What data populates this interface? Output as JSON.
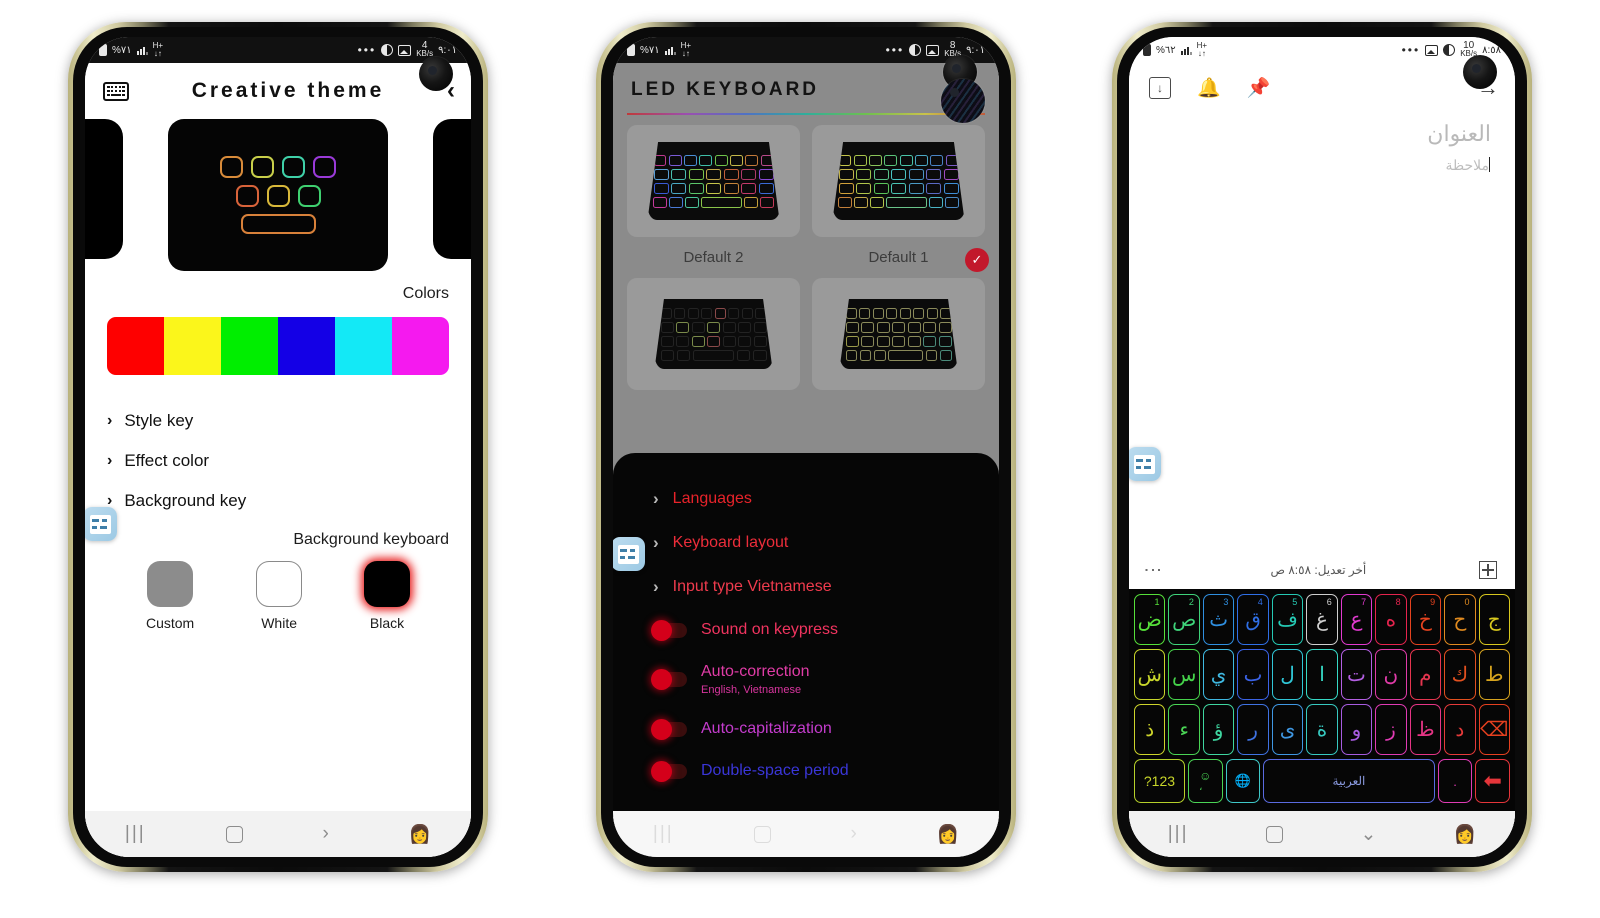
{
  "phone1": {
    "statusbar": {
      "battery": "%٧١",
      "network": "H+",
      "time": "٩:٠١",
      "data_rate": "4",
      "data_unit": "KB/s",
      "overflow": "•••"
    },
    "appbar": {
      "title": "Creative theme",
      "keyboard_icon": "keyboard-icon",
      "back_icon": "chevron-left-icon"
    },
    "preview": {
      "name": "creative-theme-preview"
    },
    "colors_label": "Colors",
    "palette": [
      "#fe0000",
      "#fbf61b",
      "#00ee00",
      "#1400e6",
      "#13e9f6",
      "#f519ef"
    ],
    "list": [
      {
        "label": "Style key",
        "chevron": "›"
      },
      {
        "label": "Effect color",
        "chevron": "›"
      },
      {
        "label": "Background key",
        "chevron": "›"
      }
    ],
    "background_keyboard_label": "Background keyboard",
    "swatches": [
      {
        "label": "Custom",
        "kind": "custom"
      },
      {
        "label": "White",
        "kind": "white"
      },
      {
        "label": "Black",
        "kind": "black"
      }
    ],
    "navbar": {
      "recents": "|||",
      "home": "home-icon",
      "back": "›",
      "accessibility": "ᾜD"
    }
  },
  "phone2": {
    "statusbar": {
      "battery": "%٧١",
      "network": "H+",
      "time": "٩:٠١",
      "data_rate": "8",
      "data_unit": "KB/s",
      "overflow": "•••"
    },
    "appbar": {
      "title": "LED KEYBOARD"
    },
    "themes": [
      {
        "caption": "Default 2",
        "selected": false
      },
      {
        "caption": "Default 1",
        "selected": true
      },
      {
        "caption": "",
        "selected": false
      },
      {
        "caption": "",
        "selected": false
      }
    ],
    "check_glyph": "✓",
    "settings": [
      {
        "type": "link",
        "label": "Languages",
        "color": "#e8232a",
        "chevron": "›"
      },
      {
        "type": "link",
        "label": "Keyboard layout",
        "color": "#ec2d3a",
        "chevron": "›"
      },
      {
        "type": "link",
        "label": "Input type Vietnamese",
        "color": "#ef3b4d",
        "chevron": "›"
      },
      {
        "type": "toggle",
        "label": "Sound on keypress",
        "color": "#f0345f",
        "sub": ""
      },
      {
        "type": "toggle",
        "label": "Auto-correction",
        "color": "#e03ca6",
        "sub": "English, Vietnamese"
      },
      {
        "type": "toggle",
        "label": "Auto-capitalization",
        "color": "#c43ccd",
        "sub": ""
      },
      {
        "type": "toggle",
        "label": "Double-space period",
        "color": "#3a36d8",
        "sub": ""
      }
    ],
    "navbar": {
      "recents": "|||",
      "home": "home-icon",
      "back": "›",
      "accessibility": "ᾜD"
    }
  },
  "phone3": {
    "statusbar": {
      "battery": "%٦٢",
      "network": "H+",
      "time": "٨:٥٨",
      "data_rate": "10",
      "data_unit": "KB/s",
      "overflow": "•••"
    },
    "appbar": {
      "save_icon": "save-to-box-icon",
      "reminder_icon": "bell-add-icon",
      "pin_icon": "pin-icon",
      "forward_icon": "arrow-right-icon"
    },
    "note": {
      "title_placeholder": "العنوان",
      "body_placeholder": "ملاحظة"
    },
    "footer": {
      "more": "more-options-icon",
      "modified": "أخر تعديل: ٨:٥٨ ص",
      "add": "add-icon"
    },
    "keyboard": {
      "row1": [
        {
          "ch": "ض",
          "num": "1",
          "color": "#56e03a"
        },
        {
          "ch": "ص",
          "num": "2",
          "color": "#3fd37a"
        },
        {
          "ch": "ث",
          "num": "3",
          "color": "#2f8fe0"
        },
        {
          "ch": "ق",
          "num": "4",
          "color": "#2f6fe6"
        },
        {
          "ch": "ف",
          "num": "5",
          "color": "#25c9b4"
        },
        {
          "ch": "غ",
          "num": "6",
          "color": "#cfcfcf"
        },
        {
          "ch": "ع",
          "num": "7",
          "color": "#e23ad0"
        },
        {
          "ch": "ه",
          "num": "8",
          "color": "#e5244e"
        },
        {
          "ch": "خ",
          "num": "9",
          "color": "#e5431f"
        },
        {
          "ch": "ح",
          "num": "0",
          "color": "#e08a1f"
        },
        {
          "ch": "ج",
          "num": "",
          "color": "#d7c71e"
        }
      ],
      "row2": [
        {
          "ch": "ش",
          "color": "#c8d62a"
        },
        {
          "ch": "س",
          "color": "#45d24a"
        },
        {
          "ch": "ي",
          "color": "#3fb9e2"
        },
        {
          "ch": "ب",
          "color": "#3b63e6"
        },
        {
          "ch": "ل",
          "color": "#30c6d6"
        },
        {
          "ch": "ا",
          "color": "#36d9c5"
        },
        {
          "ch": "ت",
          "color": "#b35fe2"
        },
        {
          "ch": "ن",
          "color": "#e03ba8"
        },
        {
          "ch": "م",
          "color": "#e5354f"
        },
        {
          "ch": "ك",
          "color": "#e2501f"
        },
        {
          "ch": "ط",
          "color": "#d7a41e"
        }
      ],
      "row3": [
        {
          "ch": "ذ",
          "color": "#cdd42b"
        },
        {
          "ch": "ء",
          "color": "#4ad455"
        },
        {
          "ch": "ؤ",
          "color": "#3fd6a0"
        },
        {
          "ch": "ر",
          "color": "#3f72e2"
        },
        {
          "ch": "ى",
          "color": "#3f97e2"
        },
        {
          "ch": "ة",
          "color": "#37c9c0"
        },
        {
          "ch": "و",
          "color": "#a75ce0"
        },
        {
          "ch": "ز",
          "color": "#e03bb4"
        },
        {
          "ch": "ظ",
          "color": "#e53585"
        },
        {
          "ch": "د",
          "color": "#e53a3a"
        },
        {
          "ch": "⌫",
          "color": "#e5401f"
        }
      ],
      "row4": {
        "symbols": "?123",
        "emoji": "☺",
        "emoji_sub": "،",
        "globe": "ἱ0",
        "space": "العربية",
        "period": ".",
        "enter": "↵"
      }
    },
    "navbar": {
      "recents": "|||",
      "home": "home-icon",
      "down": "⌄",
      "accessibility": "ᾜD"
    }
  }
}
